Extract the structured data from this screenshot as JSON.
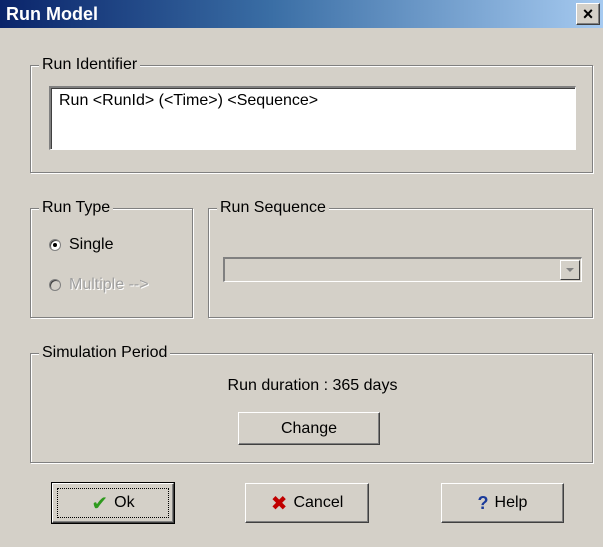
{
  "window": {
    "title": "Run Model",
    "close_glyph": "×"
  },
  "run_identifier": {
    "legend": "Run Identifier",
    "value": "Run <RunId> (<Time>) <Sequence>"
  },
  "run_type": {
    "legend": "Run Type",
    "options": [
      {
        "label": "Single",
        "checked": true,
        "enabled": true
      },
      {
        "label": "Multiple -->",
        "checked": false,
        "enabled": false
      }
    ]
  },
  "run_sequence": {
    "legend": "Run Sequence",
    "selected": ""
  },
  "simulation_period": {
    "legend": "Simulation Period",
    "duration_text": "Run duration : 365 days",
    "change_label": "Change"
  },
  "buttons": {
    "ok_label": "Ok",
    "cancel_label": "Cancel",
    "help_label": "Help"
  },
  "icons": {
    "ok": "check-icon",
    "cancel": "x-icon",
    "help": "question-mark-icon"
  }
}
